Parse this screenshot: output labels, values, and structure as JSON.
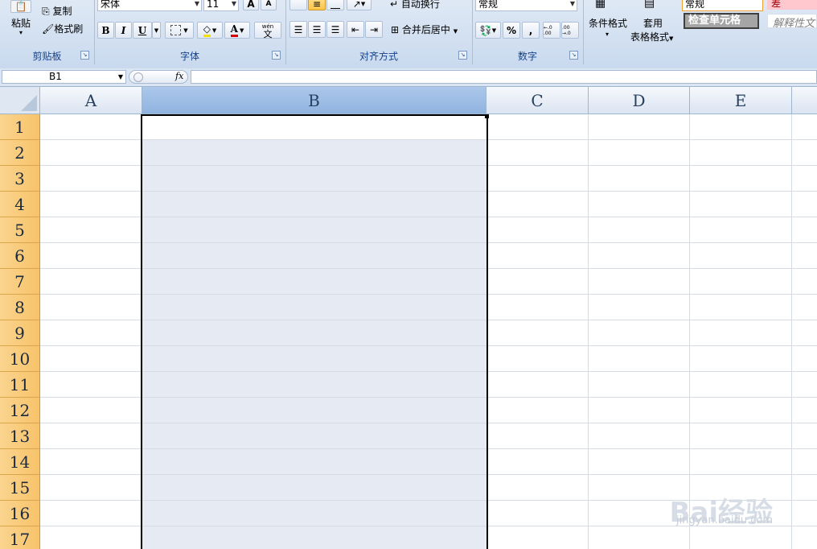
{
  "ribbon": {
    "clipboard": {
      "paste": "粘贴",
      "copy": "复制",
      "format_painter": "格式刷",
      "group_label": "剪贴板"
    },
    "font": {
      "font_name": "宋体",
      "font_size": "11",
      "bold": "B",
      "italic": "I",
      "underline": "U",
      "font_color_glyph": "A",
      "phonetic_glyph": "wén",
      "phonetic_char": "文",
      "group_label": "字体"
    },
    "alignment": {
      "wrap_text": "自动换行",
      "merge_center": "合并后居中",
      "group_label": "对齐方式"
    },
    "number": {
      "format": "常规",
      "percent": "%",
      "comma": ",",
      "inc_decimal": "←.0 .00",
      "dec_decimal": ".00 →.0",
      "group_label": "数字"
    },
    "styles": {
      "conditional": "条件格式",
      "table_format_1": "套用",
      "table_format_2": "表格格式",
      "style_normal": "常规",
      "style_bad": "差",
      "style_check": "检查单元格",
      "style_explain": "解释性文"
    }
  },
  "formula_bar": {
    "name_box": "B1",
    "fx": "fx",
    "value": ""
  },
  "columns": [
    "A",
    "B",
    "C",
    "D",
    "E"
  ],
  "rows": [
    "1",
    "2",
    "3",
    "4",
    "5",
    "6",
    "7",
    "8",
    "9",
    "10",
    "11",
    "12",
    "13",
    "14",
    "15",
    "16",
    "17"
  ],
  "watermark": {
    "brand": "Bai经验",
    "url": "jingyan.baidu.com"
  },
  "colors": {
    "selection_fill": "#e6eaf3",
    "row_header": "#f7c36a",
    "selected_col_header": "#9fbde6"
  }
}
